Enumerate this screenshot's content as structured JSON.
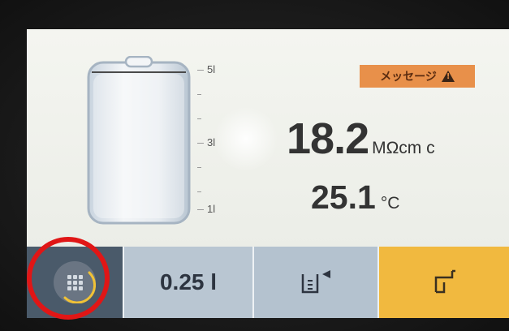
{
  "tank": {
    "scale_labels": [
      "5l",
      "3l",
      "1l"
    ]
  },
  "message": {
    "label": "メッセージ",
    "icon": "warning-icon",
    "color": "#e8904a"
  },
  "readings": {
    "resistivity_value": "18.2",
    "resistivity_unit": "MΩcm c",
    "temperature_value": "25.1",
    "temperature_unit": "°C"
  },
  "bottom_bar": {
    "menu_icon": "grid-menu-icon",
    "volume_label": "0.25 l",
    "dispense_icon": "volumetric-dispense-icon",
    "faucet_icon": "faucet-icon",
    "colors": {
      "menu": "#4a5a6a",
      "volume": "#b9c6d2",
      "faucet": "#f1b93f"
    }
  },
  "annotation": {
    "highlight_color": "#e01616"
  }
}
